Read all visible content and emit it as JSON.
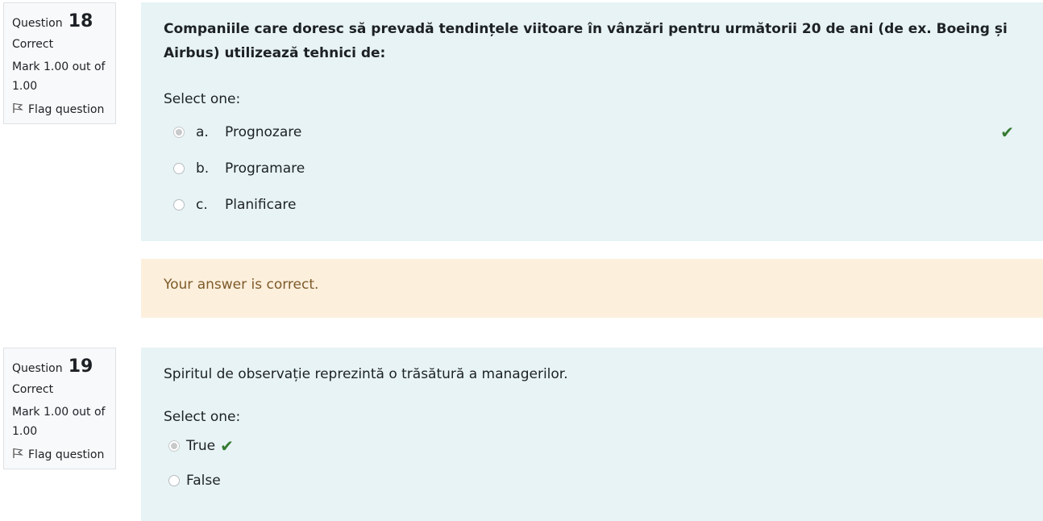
{
  "q18": {
    "label": "Question",
    "number": "18",
    "state": "Correct",
    "grade": "Mark 1.00 out of 1.00",
    "flag": "Flag question",
    "text": "Companiile care doresc să prevadă tendințele viitoare în vânzări pentru următorii 20 de ani (de ex. Boeing și Airbus) utilizează tehnici de:",
    "prompt": "Select one:",
    "options": [
      {
        "letter": "a.",
        "text": "Prognozare",
        "selected": true
      },
      {
        "letter": "b.",
        "text": "Programare",
        "selected": false
      },
      {
        "letter": "c.",
        "text": "Planificare",
        "selected": false
      }
    ],
    "feedback": "Your answer is correct."
  },
  "q19": {
    "label": "Question",
    "number": "19",
    "state": "Correct",
    "grade": "Mark 1.00 out of 1.00",
    "flag": "Flag question",
    "text": "Spiritul de observație reprezintă o trăsătură a managerilor.",
    "prompt": "Select one:",
    "options": [
      {
        "text": "True",
        "selected": true
      },
      {
        "text": "False",
        "selected": false
      }
    ]
  },
  "icons": {
    "correct": "check-icon",
    "flag": "flag-icon"
  },
  "colors": {
    "formulation_bg": "#e7f3f5",
    "feedback_bg": "#fcefdc",
    "correct": "#357a32"
  }
}
